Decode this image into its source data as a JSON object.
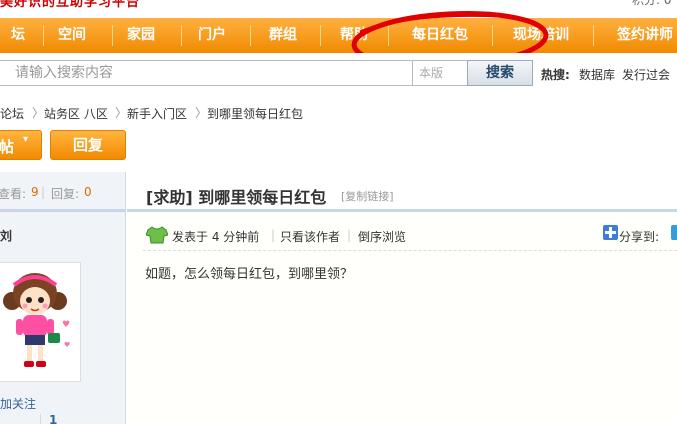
{
  "top": {
    "slogan": "美好识的互助学习平台",
    "right": "积分: 0"
  },
  "nav": {
    "items": [
      {
        "label": "坛"
      },
      {
        "label": "空间"
      },
      {
        "label": "家园"
      },
      {
        "label": "门户"
      },
      {
        "label": "群组"
      },
      {
        "label": "帮助"
      },
      {
        "label": "每日红包"
      },
      {
        "label": "现场培训"
      },
      {
        "label": "签约讲师"
      }
    ]
  },
  "search": {
    "placeholder": "请输入搜索内容",
    "scope": "本版",
    "button": "搜索"
  },
  "hot": {
    "label": "热搜:",
    "links": [
      "数据库",
      "发行过会"
    ]
  },
  "breadcrumb": [
    "论坛",
    "站务区 八区",
    "新手入门区",
    "到哪里领每日红包"
  ],
  "actions": {
    "newpost": "帖",
    "reply": "回复"
  },
  "stats": {
    "views_label": "查看:",
    "views": "9",
    "replies_label": "回复:",
    "replies": "0"
  },
  "post": {
    "title": "[求助] 到哪里领每日红包",
    "copy_link": "[复制链接]",
    "posted": "发表于 4 分钟前",
    "only_author": "只看该作者",
    "reverse": "倒序浏览",
    "share": "分享到:",
    "body": "如题，怎么领每日红包，到哪里领？"
  },
  "author": {
    "name": "刘",
    "follow": "加关注",
    "stat": "1"
  },
  "colors": {
    "nav_orange": "#f08a00",
    "annotation_red": "#e00000"
  }
}
